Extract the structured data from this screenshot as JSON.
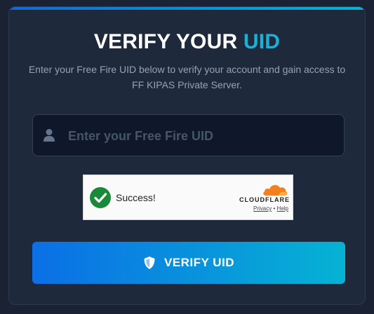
{
  "header": {
    "title_main": "VERIFY YOUR",
    "title_accent": "UID",
    "subtitle": "Enter your Free Fire UID below to verify your account and gain access to FF KIPAS Private Server."
  },
  "form": {
    "uid_placeholder": "Enter your Free Fire UID",
    "uid_value": "",
    "user_icon": "user-icon"
  },
  "captcha": {
    "status_text": "Success!",
    "brand": "CLOUDFLARE",
    "privacy_label": "Privacy",
    "separator": "•",
    "help_label": "Help",
    "check_color": "#1a8a3a",
    "brand_color": "#f38020"
  },
  "actions": {
    "verify_label": "VERIFY UID",
    "verify_icon": "shield-icon"
  },
  "colors": {
    "accent": "#1ab1d6",
    "button_start": "#0b6fe6",
    "button_end": "#06b3d4"
  }
}
